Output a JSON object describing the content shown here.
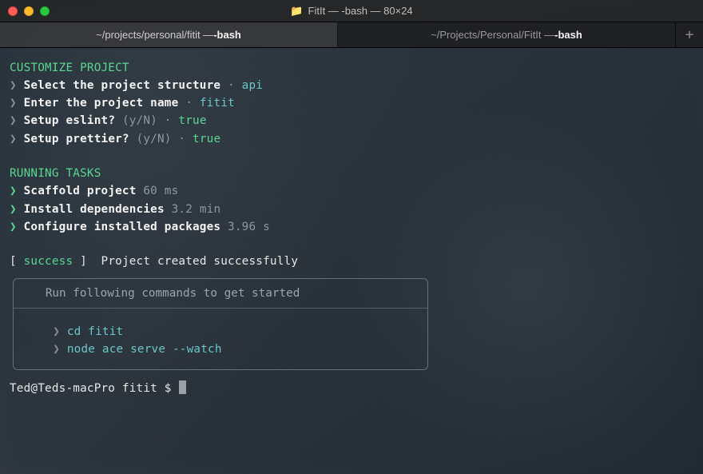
{
  "titlebar": {
    "folder_icon": "📁",
    "title": "FitIt — -bash — 80×24"
  },
  "tabs": [
    {
      "path": "~/projects/personal/fitit — ",
      "proc": "-bash",
      "active": true
    },
    {
      "path": "~/Projects/Personal/FitIt — ",
      "proc": "-bash",
      "active": false
    }
  ],
  "newtab_glyph": "+",
  "sections": {
    "customize": {
      "title": "CUSTOMIZE PROJECT",
      "lines": [
        {
          "arrow": "❯",
          "label": "Select the project structure",
          "sep": " · ",
          "hint": "",
          "value": "api",
          "value_cls": "cyan"
        },
        {
          "arrow": "❯",
          "label": "Enter the project name",
          "sep": " · ",
          "hint": "",
          "value": "fitit",
          "value_cls": "cyan"
        },
        {
          "arrow": "❯",
          "label": "Setup eslint?",
          "sep": " · ",
          "hint": "(y/N)",
          "value": "true",
          "value_cls": "green"
        },
        {
          "arrow": "❯",
          "label": "Setup prettier?",
          "sep": " · ",
          "hint": "(y/N)",
          "value": "true",
          "value_cls": "green"
        }
      ]
    },
    "tasks": {
      "title": "RUNNING TASKS",
      "lines": [
        {
          "arrow": "❯",
          "arrow_cls": "arrow-green",
          "label": "Scaffold project",
          "time": "60 ms"
        },
        {
          "arrow": "❯",
          "arrow_cls": "arrow-green",
          "label": "Install dependencies",
          "time": "3.2 min"
        },
        {
          "arrow": "❯",
          "arrow_cls": "arrow-green",
          "label": "Configure installed packages",
          "time": "3.96 s"
        }
      ]
    },
    "status": {
      "open": "[ ",
      "tag": "success",
      "close": " ]  ",
      "message": "Project created successfully"
    },
    "instructions": {
      "header": "   Run following commands to get started",
      "commands": [
        {
          "indent": "    ",
          "arrow": "❯",
          "cmd": "cd fitit"
        },
        {
          "indent": "    ",
          "arrow": "❯",
          "cmd": "node ace serve --watch"
        }
      ]
    }
  },
  "prompt": {
    "text": "Ted@Teds-macPro fitit $ "
  }
}
